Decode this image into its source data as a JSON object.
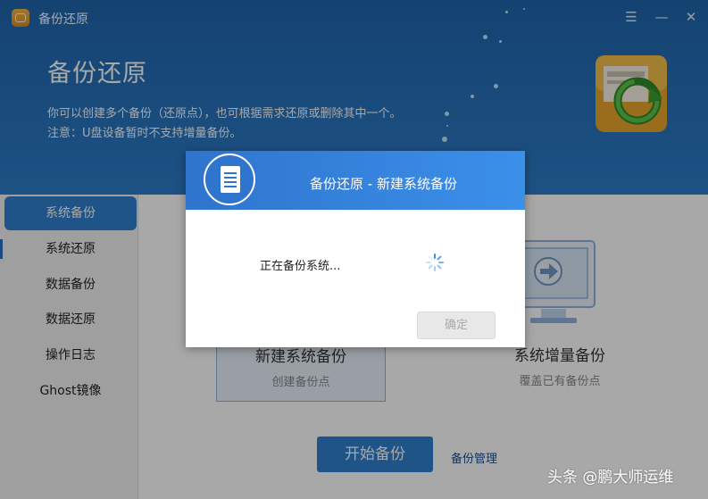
{
  "window": {
    "title": "备份还原",
    "menu_icon": "hamburger-icon",
    "min_icon": "minimize-icon",
    "close_icon": "close-icon"
  },
  "header": {
    "title": "备份还原",
    "line1": "你可以创建多个备份（还原点），也可根据需求还原或删除其中一个。",
    "line2": "注意：U盘设备暂时不支持增量备份。",
    "hero_icon": "backup-restore-icon"
  },
  "sidebar": {
    "items": [
      {
        "label": "系统备份",
        "active": true
      },
      {
        "label": "系统还原"
      },
      {
        "label": "数据备份"
      },
      {
        "label": "数据还原"
      },
      {
        "label": "操作日志"
      },
      {
        "label": "Ghost镜像"
      }
    ]
  },
  "main": {
    "cards": [
      {
        "title": "新建系统备份",
        "subtitle": "创建备份点"
      },
      {
        "title": "系统增量备份",
        "subtitle": "覆盖已有备份点"
      }
    ],
    "start_button": "开始备份",
    "manage_link": "备份管理"
  },
  "dialog": {
    "title": "备份还原 - 新建系统备份",
    "message": "正在备份系统...",
    "ok_button": "确定",
    "logo_icon": "document-icon",
    "spinner_icon": "loading-spinner-icon"
  },
  "watermark": "头条 @鹏大师运维",
  "colors": {
    "header": "#2d7dc9",
    "accent": "#2f80d1",
    "dialog_header": "#3b90ea"
  }
}
